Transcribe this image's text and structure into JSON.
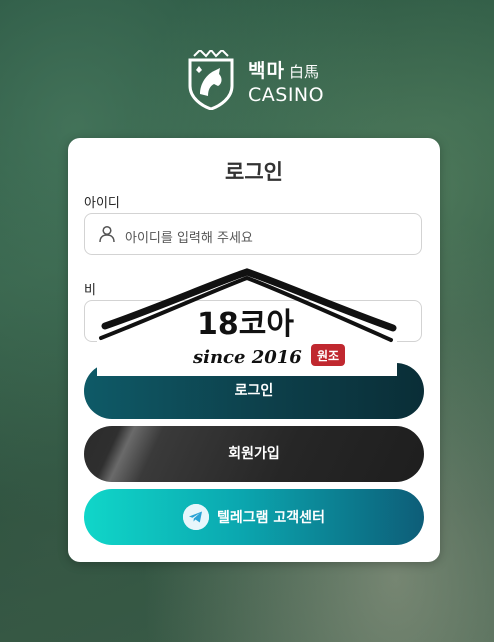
{
  "brand": {
    "name_kr": "백마",
    "name_hanja": "白馬",
    "name_en": "CASINO"
  },
  "login_form": {
    "title": "로그인",
    "id_label": "아이디",
    "id_placeholder": "아이디를 입력해 주세요",
    "pw_label": "비",
    "login_button": "로그인",
    "signup_button": "회원가입",
    "telegram_button": "텔레그램 고객센터"
  },
  "watermark": {
    "text_main": "18코아",
    "text_since": "since 2016",
    "badge": "원조"
  },
  "colors": {
    "accent_teal": "#0ba8b0",
    "dark_teal": "#0d3f4a",
    "badge_red": "#c0282f"
  }
}
